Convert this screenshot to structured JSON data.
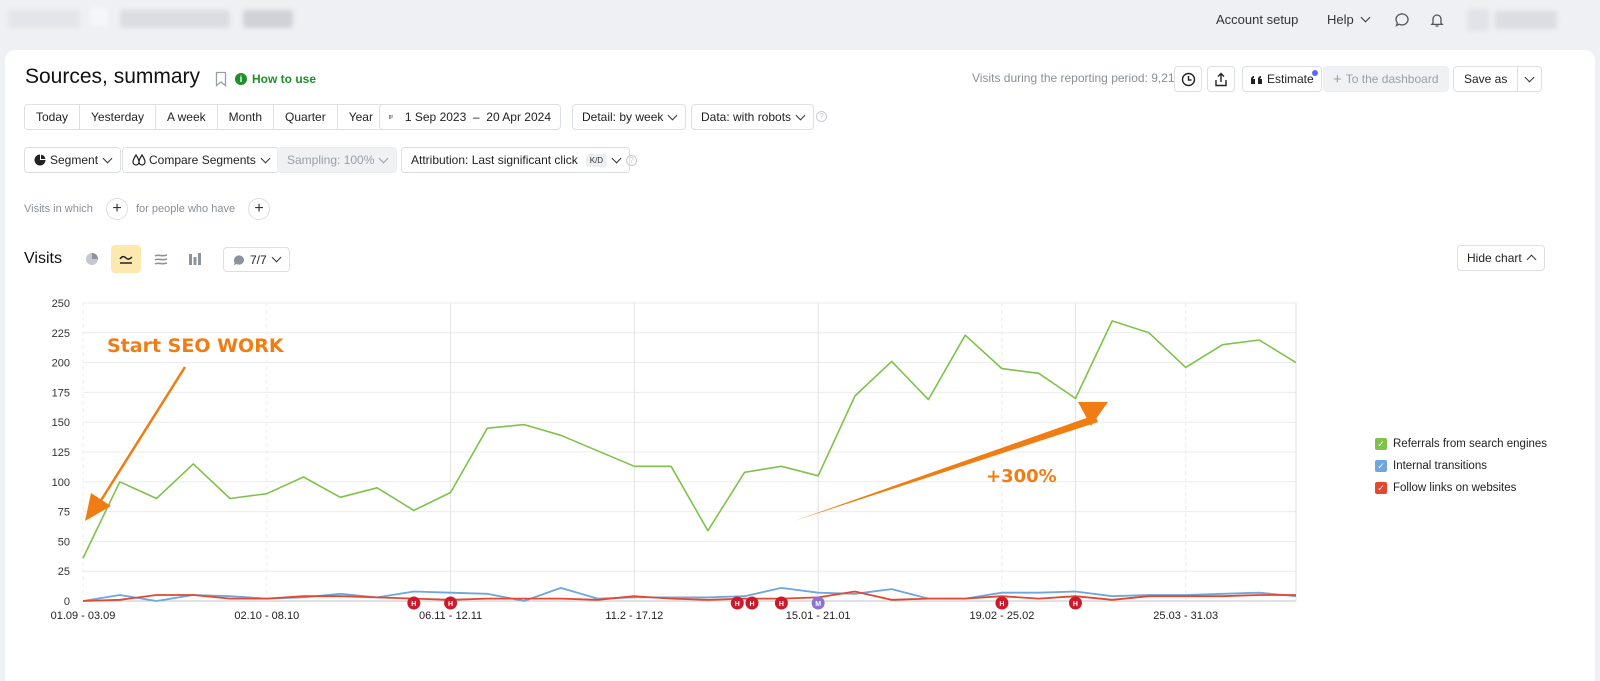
{
  "top_nav": {
    "account_setup": "Account setup",
    "help": "Help"
  },
  "header": {
    "title": "Sources, summary",
    "how_to_use": "How to use",
    "visits_total": "Visits during the reporting period: 9,215",
    "estimate": "Estimate",
    "to_dashboard": "To the dashboard",
    "save_as": "Save as"
  },
  "periods": [
    "Today",
    "Yesterday",
    "A week",
    "Month",
    "Quarter",
    "Year"
  ],
  "date_range": "1 Sep 2023  –  20 Apr 2024",
  "detail": "Detail: by week",
  "data_mode": "Data: with robots",
  "segment": "Segment",
  "compare_segments": "Compare Segments",
  "sampling": "Sampling: 100%",
  "attribution": "Attribution: Last significant click",
  "attribution_badge": "K/D",
  "filters": {
    "visits_in_which": "Visits in which",
    "for_people": "for people who have"
  },
  "chart_header": {
    "label": "Visits",
    "series_count": "7/7",
    "hide_chart": "Hide chart"
  },
  "colors": {
    "accent_green": "#1f8f2a",
    "series_search": "#7fc24a",
    "series_internal": "#6fa6dd",
    "series_links": "#e4472e",
    "annotation": "#f07d14",
    "marker_red": "#cc1a2c",
    "marker_purple": "#8a72d6"
  },
  "annotations": {
    "start": "Start SEO WORK",
    "growth": "+300%"
  },
  "chart_data": {
    "type": "line",
    "ylim": [
      0,
      250
    ],
    "yticks": [
      0,
      25,
      50,
      75,
      100,
      125,
      150,
      175,
      200,
      225,
      250
    ],
    "x_tick_labels": [
      "01.09 - 03.09",
      "02.10 - 08.10",
      "06.11 - 12.11",
      "11.2 - 17.12",
      "15.01 - 21.01",
      "19.02 - 25.02",
      "25.03 - 31.03"
    ],
    "x_tick_index": [
      0,
      5,
      10,
      15,
      20,
      25,
      30
    ],
    "n_points": 34,
    "series": [
      {
        "name": "Referrals from search engines",
        "color": "#7fc24a",
        "values": [
          36,
          100,
          86,
          115,
          86,
          90,
          104,
          87,
          95,
          76,
          91,
          145,
          148,
          139,
          126,
          113,
          113,
          59,
          108,
          113,
          105,
          172,
          201,
          169,
          223,
          195,
          191,
          170,
          235,
          225,
          196,
          215,
          219,
          200
        ]
      },
      {
        "name": "Internal transitions",
        "color": "#6fa6dd",
        "values": [
          0,
          5,
          0,
          5,
          4,
          2,
          3,
          6,
          3,
          8,
          7,
          6,
          0,
          11,
          2,
          3,
          3,
          3,
          4,
          11,
          7,
          6,
          10,
          2,
          2,
          7,
          7,
          8,
          4,
          5,
          5,
          6,
          7,
          4
        ]
      },
      {
        "name": "Follow links on websites",
        "color": "#e4472e",
        "values": [
          0,
          1,
          5,
          5,
          2,
          2,
          4,
          4,
          3,
          2,
          1,
          2,
          2,
          2,
          1,
          4,
          2,
          1,
          2,
          2,
          3,
          8,
          1,
          2,
          2,
          4,
          2,
          4,
          1,
          4,
          4,
          4,
          5,
          5
        ]
      }
    ],
    "events": [
      {
        "index": 9,
        "label": "H"
      },
      {
        "index": 10,
        "label": "H"
      },
      {
        "index": 17.8,
        "label": "H"
      },
      {
        "index": 18.2,
        "label": "H"
      },
      {
        "index": 19,
        "label": "H"
      },
      {
        "index": 20,
        "label": "M"
      },
      {
        "index": 25,
        "label": "H"
      },
      {
        "index": 27,
        "label": "H"
      }
    ]
  }
}
